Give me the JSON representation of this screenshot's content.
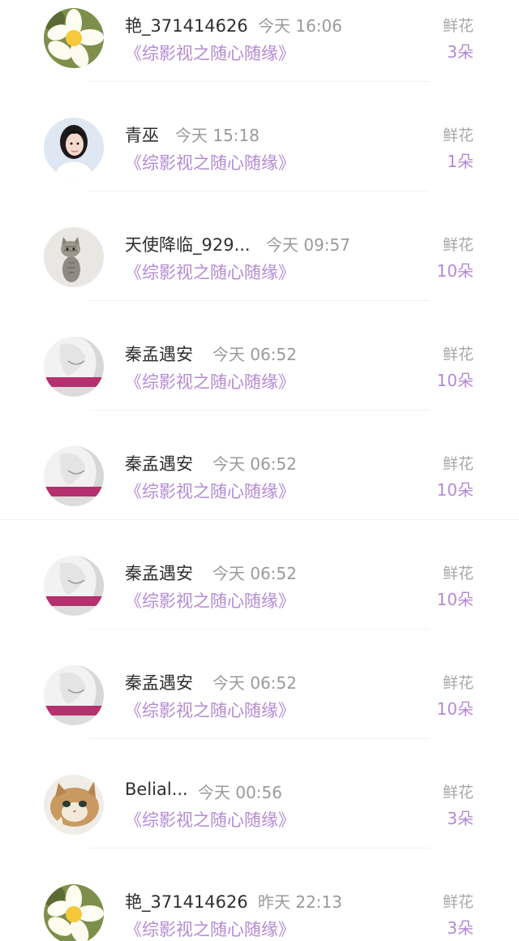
{
  "gift_label": "鲜花",
  "accent_color": "#b48ad3",
  "entries": [
    {
      "avatar": "frangipani-flower",
      "user": "艳_371414626",
      "time": "今天 16:06",
      "work": "《综影视之随心随缘》",
      "flowers": "3朵"
    },
    {
      "avatar": "girl-portrait",
      "user": "青巫",
      "time": "今天 15:18",
      "work": "《综影视之随心随缘》",
      "flowers": "1朵"
    },
    {
      "avatar": "kitten",
      "user": "天使降临_929...",
      "time": "今天 09:57",
      "work": "《综影视之随心随缘》",
      "flowers": "10朵"
    },
    {
      "avatar": "bw-portrait-pink-banner",
      "user": "秦孟遇安",
      "time": "今天 06:52",
      "work": "《综影视之随心随缘》",
      "flowers": "10朵"
    },
    {
      "avatar": "bw-portrait-pink-banner",
      "user": "秦孟遇安",
      "time": "今天 06:52",
      "work": "《综影视之随心随缘》",
      "flowers": "10朵"
    },
    {
      "avatar": "bw-portrait-pink-banner",
      "user": "秦孟遇安",
      "time": "今天 06:52",
      "work": "《综影视之随心随缘》",
      "flowers": "10朵"
    },
    {
      "avatar": "bw-portrait-pink-banner",
      "user": "秦孟遇安",
      "time": "今天 06:52",
      "work": "《综影视之随心随缘》",
      "flowers": "10朵"
    },
    {
      "avatar": "cat",
      "user": "Belial...",
      "time": "今天 00:56",
      "work": "《综影视之随心随缘》",
      "flowers": "3朵"
    },
    {
      "avatar": "frangipani-flower",
      "user": "艳_371414626",
      "time": "昨天 22:13",
      "work": "《综影视之随心随缘》",
      "flowers": "3朵"
    }
  ]
}
